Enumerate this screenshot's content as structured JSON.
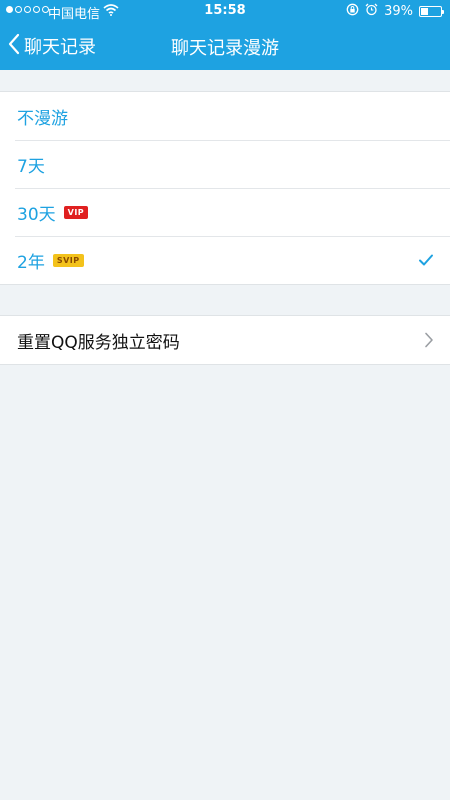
{
  "status_bar": {
    "carrier": "中国电信",
    "time": "15:58",
    "battery_text": "39%",
    "battery_level": 0.39,
    "signal_dots_filled": 1,
    "signal_dots_total": 5,
    "icons": [
      "signal-dots-icon",
      "wifi-icon",
      "rotation-lock-icon",
      "alarm-icon",
      "battery-icon"
    ]
  },
  "nav": {
    "back_label": "聊天记录",
    "title": "聊天记录漫游",
    "back_icon": "chevron-left-icon"
  },
  "roaming_options": [
    {
      "label": "不漫游",
      "badge": "",
      "selected": false
    },
    {
      "label": "7天",
      "badge": "",
      "selected": false
    },
    {
      "label": "30天",
      "badge": "VIP",
      "selected": false
    },
    {
      "label": "2年",
      "badge": "SVIP",
      "selected": true
    }
  ],
  "settings": {
    "reset_password_label": "重置QQ服务独立密码"
  },
  "colors": {
    "accent": "#1ea2e1",
    "vip_badge": "#e02020",
    "svip_badge": "#f3c21b",
    "background": "#eff3f6"
  }
}
